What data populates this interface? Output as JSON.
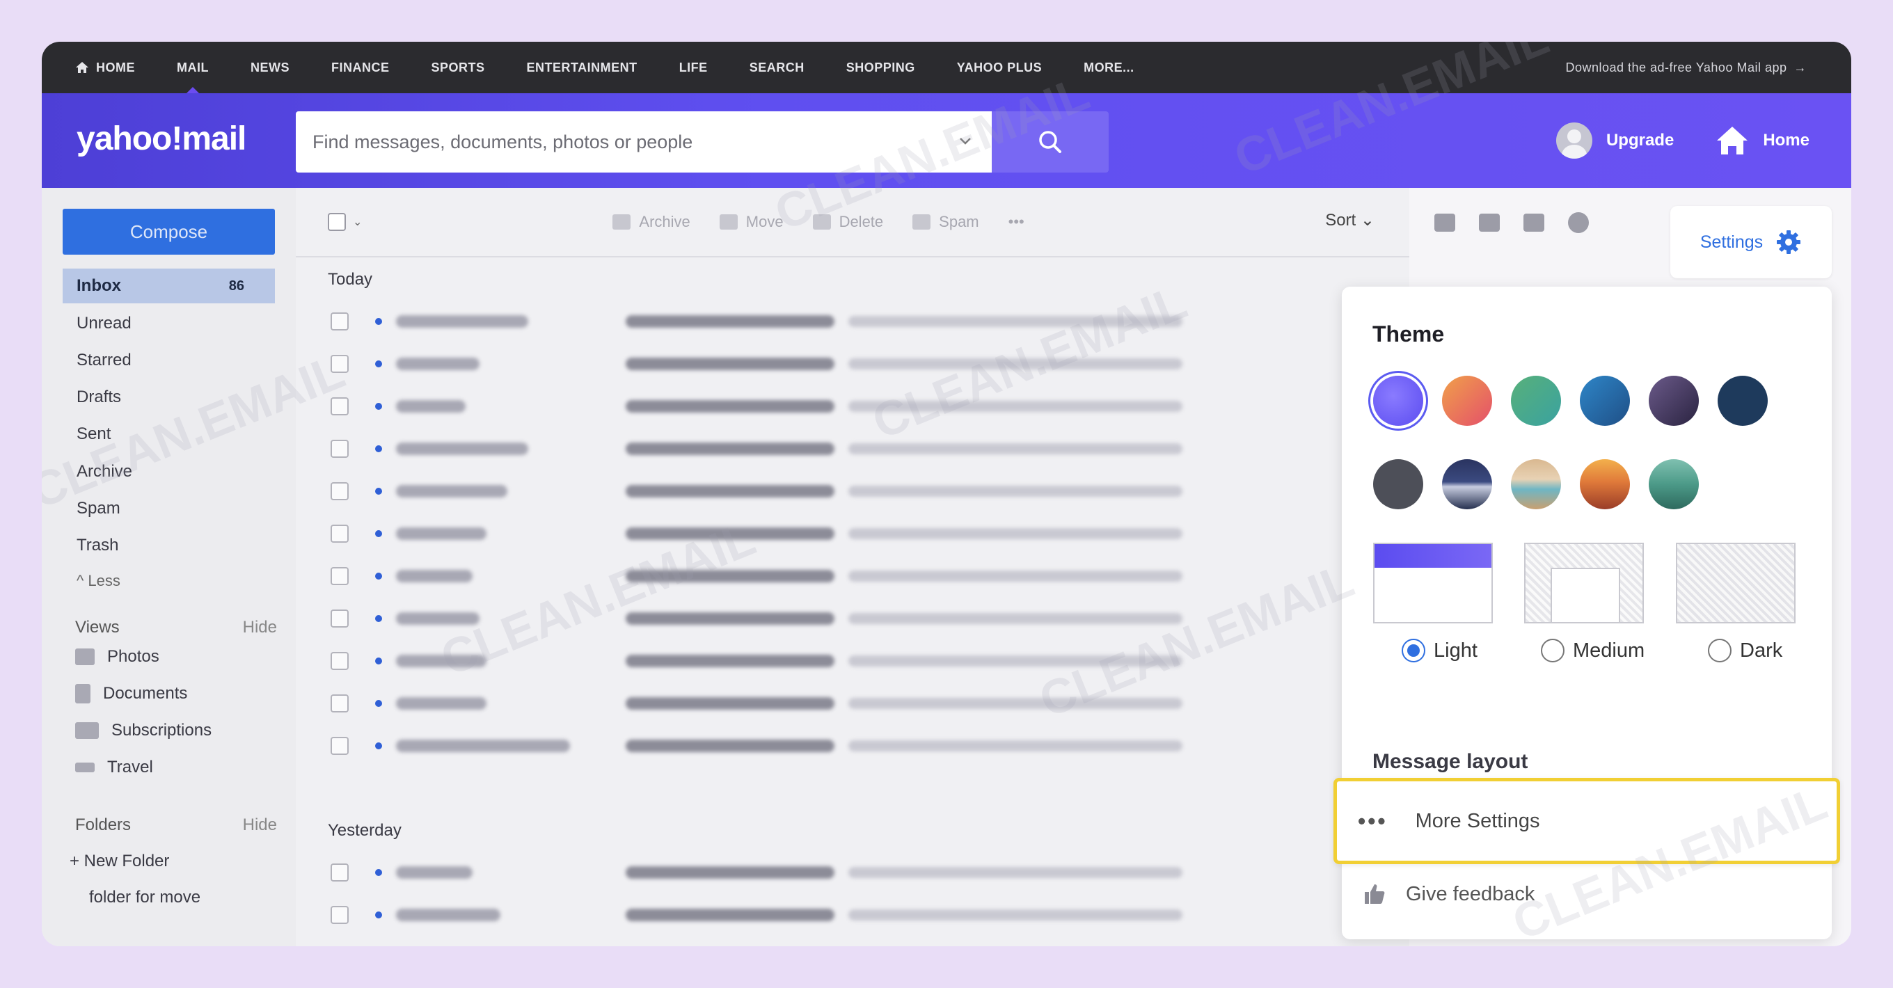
{
  "topnav": {
    "items": [
      "HOME",
      "MAIL",
      "NEWS",
      "FINANCE",
      "SPORTS",
      "ENTERTAINMENT",
      "LIFE",
      "SEARCH",
      "SHOPPING",
      "YAHOO PLUS",
      "MORE..."
    ],
    "active_index": 1,
    "download_text": "Download the ad-free Yahoo Mail app",
    "arrow": "→"
  },
  "header": {
    "logo": "yahoo!mail",
    "search_placeholder": "Find messages, documents, photos or people",
    "upgrade": "Upgrade",
    "home": "Home"
  },
  "sidebar": {
    "compose": "Compose",
    "folders": [
      {
        "label": "Inbox",
        "count": "86"
      },
      {
        "label": "Unread"
      },
      {
        "label": "Starred"
      },
      {
        "label": "Drafts"
      },
      {
        "label": "Sent"
      },
      {
        "label": "Archive"
      },
      {
        "label": "Spam"
      },
      {
        "label": "Trash"
      }
    ],
    "less": "^ Less",
    "views_label": "Views",
    "views_hide": "Hide",
    "views": [
      "Photos",
      "Documents",
      "Subscriptions",
      "Travel"
    ],
    "folders_label": "Folders",
    "folders_hide": "Hide",
    "new_folder": "+ New Folder",
    "custom_folder": "folder for move"
  },
  "toolbar": {
    "archive": "Archive",
    "move": "Move",
    "delete": "Delete",
    "spam": "Spam",
    "more": "•••",
    "sort": "Sort"
  },
  "mail": {
    "today": "Today",
    "yesterday": "Yesterday"
  },
  "settings": {
    "button": "Settings",
    "theme_title": "Theme",
    "accent": "#5b5bf0",
    "modes": [
      "Light",
      "Medium",
      "Dark"
    ],
    "selected_mode": "Light",
    "message_layout": "Message layout",
    "more_settings": "More Settings",
    "feedback": "Give feedback"
  },
  "watermark": "CLEAN.EMAIL"
}
